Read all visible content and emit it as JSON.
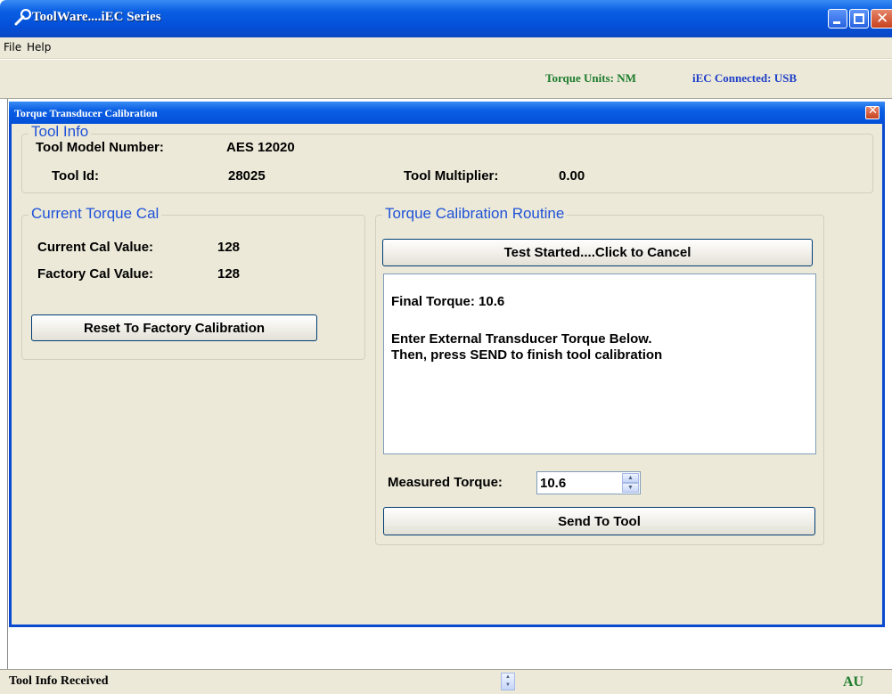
{
  "window": {
    "title": "ToolWare....iEC Series",
    "accent_color": "#0a5fe3"
  },
  "menu": {
    "items": [
      {
        "label": "File"
      },
      {
        "label": "Help"
      }
    ]
  },
  "status_top": {
    "torque_units": "Torque Units: NM",
    "connection": "iEC Connected: USB"
  },
  "dialog": {
    "title": "Torque Transducer Calibration",
    "tool_info": {
      "legend": "Tool Info",
      "model_label": "Tool Model Number:",
      "model_value": "AES 12020",
      "id_label": "Tool Id:",
      "id_value": "28025",
      "multiplier_label": "Tool Multiplier:",
      "multiplier_value": "0.00"
    },
    "current_cal": {
      "legend": "Current Torque Cal",
      "current_label": "Current Cal Value:",
      "current_value": "128",
      "factory_label": "Factory Cal Value:",
      "factory_value": "128",
      "reset_button": "Reset To Factory Calibration"
    },
    "routine": {
      "legend": "Torque Calibration Routine",
      "test_button": "Test Started....Click to Cancel",
      "message_lines": [
        "Final Torque: 10.6",
        "Enter External Transducer Torque Below.",
        "Then, press SEND to finish tool calibration"
      ],
      "measured_label": "Measured Torque:",
      "measured_value": "10.6",
      "send_button": "Send To Tool"
    }
  },
  "status_bottom": {
    "text": "Tool Info Received",
    "indicator": "AU"
  }
}
